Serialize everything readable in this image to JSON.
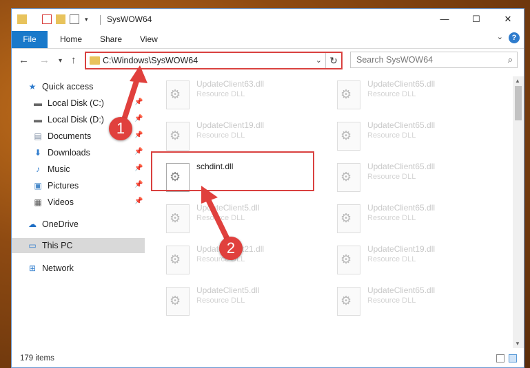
{
  "window": {
    "title": "SysWOW64",
    "controls": {
      "minimize": "—",
      "maximize": "☐",
      "close": "✕"
    }
  },
  "ribbon": {
    "tabs": [
      "File",
      "Home",
      "Share",
      "View"
    ],
    "help": "?"
  },
  "address": {
    "path": "C:\\Windows\\SysWOW64",
    "search_placeholder": "Search SysWOW64"
  },
  "sidebar": {
    "items": [
      {
        "label": "Quick access",
        "icon": "star-icon"
      },
      {
        "label": "Local Disk (C:)",
        "icon": "drive-icon",
        "pinned": true
      },
      {
        "label": "Local Disk (D:)",
        "icon": "drive-icon",
        "pinned": true
      },
      {
        "label": "Documents",
        "icon": "documents-icon",
        "pinned": true
      },
      {
        "label": "Downloads",
        "icon": "downloads-icon",
        "pinned": true
      },
      {
        "label": "Music",
        "icon": "music-icon",
        "pinned": true
      },
      {
        "label": "Pictures",
        "icon": "pictures-icon",
        "pinned": true
      },
      {
        "label": "Videos",
        "icon": "videos-icon",
        "pinned": true
      },
      {
        "label": "OneDrive",
        "icon": "cloud-icon"
      },
      {
        "label": "This PC",
        "icon": "computer-icon",
        "selected": true
      },
      {
        "label": "Network",
        "icon": "network-icon"
      }
    ]
  },
  "files": {
    "left": [
      {
        "name": "UpdateClient63.dll",
        "desc": "Resource DLL"
      },
      {
        "name": "UpdateClient19.dll",
        "desc": "Resource DLL"
      },
      {
        "name": "schdint.dll",
        "desc": "",
        "highlighted": true
      },
      {
        "name": "UpdateClient5.dll",
        "desc": "Resource DLL"
      },
      {
        "name": "UpdateClient21.dll",
        "desc": "Resource DLL"
      },
      {
        "name": "UpdateClient5.dll",
        "desc": "Resource DLL"
      }
    ],
    "right": [
      {
        "name": "UpdateClient65.dll",
        "desc": "Resource DLL"
      },
      {
        "name": "UpdateClient65.dll",
        "desc": "Resource DLL"
      },
      {
        "name": "UpdateClient65.dll",
        "desc": "Resource DLL"
      },
      {
        "name": "UpdateClient65.dll",
        "desc": "Resource DLL"
      },
      {
        "name": "UpdateClient19.dll",
        "desc": "Resource DLL"
      },
      {
        "name": "UpdateClient65.dll",
        "desc": "Resource DLL"
      }
    ]
  },
  "status": {
    "item_count": "179 items"
  },
  "annotations": {
    "marker1": "1",
    "marker2": "2"
  },
  "colors": {
    "accent": "#1979ca",
    "highlight": "#d9413f",
    "selected": "#d9d9d9"
  }
}
